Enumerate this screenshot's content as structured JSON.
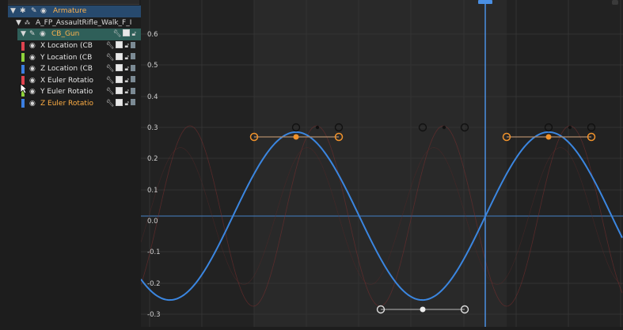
{
  "channels": [
    {
      "label": "Armature",
      "kind": "armature"
    },
    {
      "label": "A_FP_AssaultRifle_Walk_F_I",
      "kind": "action"
    },
    {
      "label": "CB_Gun",
      "kind": "group"
    },
    {
      "label": "X Location (CB",
      "kind": "fcurve",
      "color": "#e0434f"
    },
    {
      "label": "Y Location (CB",
      "kind": "fcurve",
      "color": "#8fd13b"
    },
    {
      "label": "Z Location (CB",
      "kind": "fcurve",
      "color": "#3b7ee0"
    },
    {
      "label": "X Euler Rotatio",
      "kind": "fcurve",
      "color": "#e0434f"
    },
    {
      "label": "Y Euler Rotatio",
      "kind": "fcurve",
      "color": "#8fd13b"
    },
    {
      "label": "Z Euler Rotatio",
      "kind": "fcurve",
      "color": "#3b7ee0",
      "selected": true
    }
  ],
  "graph": {
    "y_labels": [
      "0.6",
      "0.5",
      "0.4",
      "0.3",
      "0.2",
      "0.1",
      "0.0",
      "-0.1",
      "-0.2",
      "-0.3"
    ],
    "current_frame_label": "",
    "colors": {
      "curve": "#3b86e0",
      "curve_ghost": "#7a2e2e",
      "keyframe_selected": "#f0922b",
      "keyframe_unselected": "#dddddd",
      "handle_ring": "#111111",
      "playhead": "#4a8fe3",
      "zero_line": "#3f6fa6"
    },
    "icons": [
      "eye-icon",
      "wrench-icon",
      "checkbox-icon",
      "lock-icon",
      "pin-icon",
      "bone-icon",
      "disclosure-triangle-icon"
    ]
  }
}
